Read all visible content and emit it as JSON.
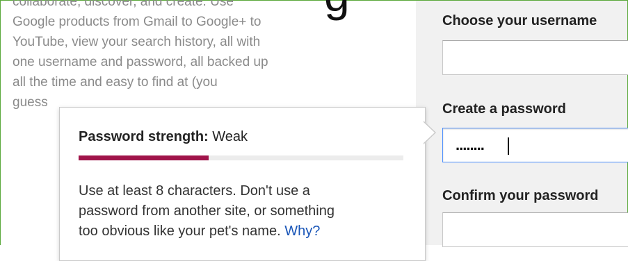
{
  "header": {
    "big_title_fragment": "g"
  },
  "intro": {
    "lines": [
      "collaborate, discover, and create. Use",
      "Google products from Gmail to Google+ to",
      "YouTube, view your search history, all with",
      "one username and password, all backed up",
      "all the time and easy to find at (you",
      "guess"
    ]
  },
  "form": {
    "username": {
      "label": "Choose your username",
      "value": ""
    },
    "password": {
      "label": "Create a password",
      "value": "........"
    },
    "confirm": {
      "label": "Confirm your password",
      "value": ""
    }
  },
  "strength_popup": {
    "title_label": "Password strength:",
    "title_value": "Weak",
    "strength_fraction": 0.4,
    "strength_color": "#a0144a",
    "advice_lines": [
      "Use at least 8 characters. Don't use a",
      "password from another site, or something",
      "too obvious like your pet's name."
    ],
    "why_link": "Why?"
  }
}
